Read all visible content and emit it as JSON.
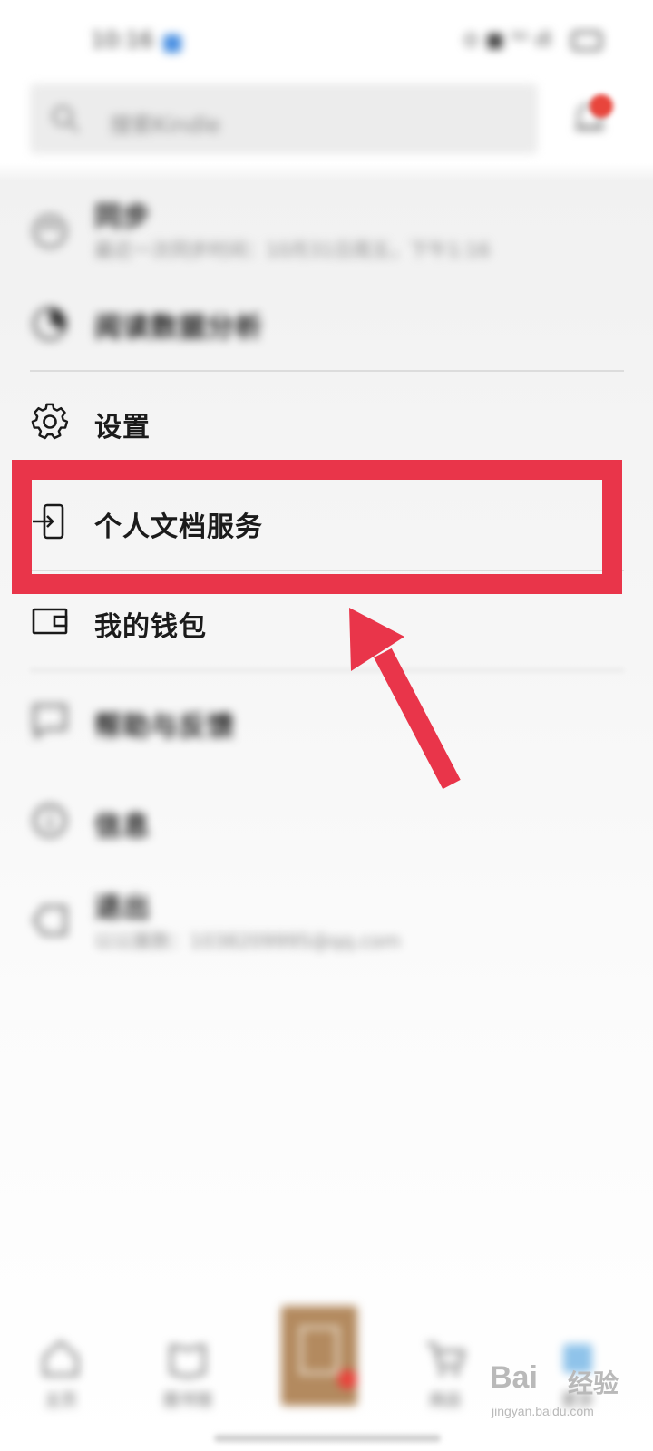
{
  "status_bar": {
    "time": "10:16",
    "signal_text": "⊙ ■ ⁵ᴳ ıll"
  },
  "search": {
    "placeholder": "搜索Kindle"
  },
  "menu": {
    "items": [
      {
        "label": "同步",
        "sub": "最近一次同步时间：10月31日周五，下午1:16",
        "icon": "sync-icon"
      },
      {
        "label": "阅读数据分析",
        "icon": "reading-stats-icon"
      },
      {
        "label": "设置",
        "icon": "gear-icon"
      },
      {
        "label": "个人文档服务",
        "icon": "document-import-icon"
      },
      {
        "label": "我的钱包",
        "icon": "wallet-icon"
      },
      {
        "label": "帮助与反馈",
        "icon": "feedback-icon"
      },
      {
        "label": "信息",
        "icon": "info-icon"
      },
      {
        "label": "退出",
        "sub": "以以展数：1038209995@qq.com",
        "icon": "logout-icon"
      }
    ]
  },
  "bottom_nav": {
    "items": [
      {
        "label": "主页",
        "icon": "home-icon"
      },
      {
        "label": "图书馆",
        "icon": "library-icon"
      },
      {
        "label": "",
        "icon": "current-book-icon"
      },
      {
        "label": "商店",
        "icon": "cart-icon"
      },
      {
        "label": "更多",
        "icon": "more-icon"
      }
    ]
  },
  "watermark": {
    "brand": "Bai",
    "brand_cn": "经验",
    "url": "jingyan.baidu.com"
  },
  "colors": {
    "highlight": "#e9354a",
    "badge": "#e8453c",
    "accent_blue": "#4a90e2"
  }
}
